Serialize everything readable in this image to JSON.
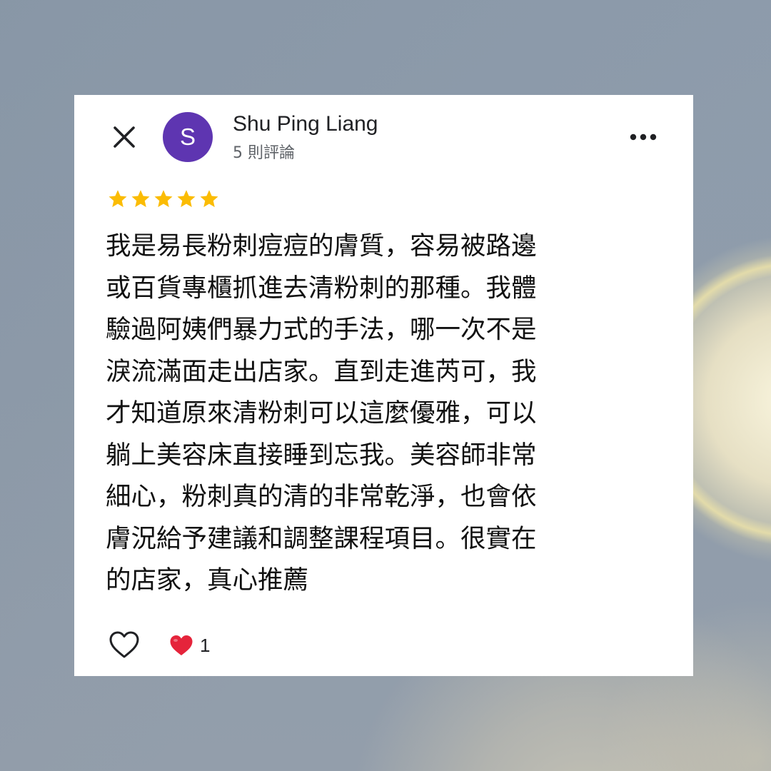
{
  "reviewer": {
    "avatar_initial": "S",
    "avatar_color": "#5e35b1",
    "name": "Shu Ping Liang",
    "review_count": "5 則評論"
  },
  "rating": {
    "stars": 5,
    "max": 5,
    "star_color": "#fbbc04"
  },
  "review": {
    "lines": [
      "我是易長粉刺痘痘的膚質，容易被路邊",
      "或百貨專櫃抓進去清粉刺的那種。我體",
      "驗過阿姨們暴力式的手法，哪一次不是",
      "淚流滿面走出店家。直到走進芮可，我",
      "才知道原來清粉刺可以這麼優雅，可以",
      "躺上美容床直接睡到忘我。美容師非常",
      "細心，粉刺真的清的非常乾淨，也會依",
      "膚況給予建議和調整課程項目。很實在",
      "的店家，真心推薦"
    ]
  },
  "reactions": {
    "heart_count": "1",
    "heart_color": "#e5243b"
  },
  "icons": {
    "close": "close-icon",
    "more": "more-horizontal-icon",
    "like": "heart-outline-icon",
    "reaction": "heart-filled-icon",
    "star": "star-icon"
  }
}
